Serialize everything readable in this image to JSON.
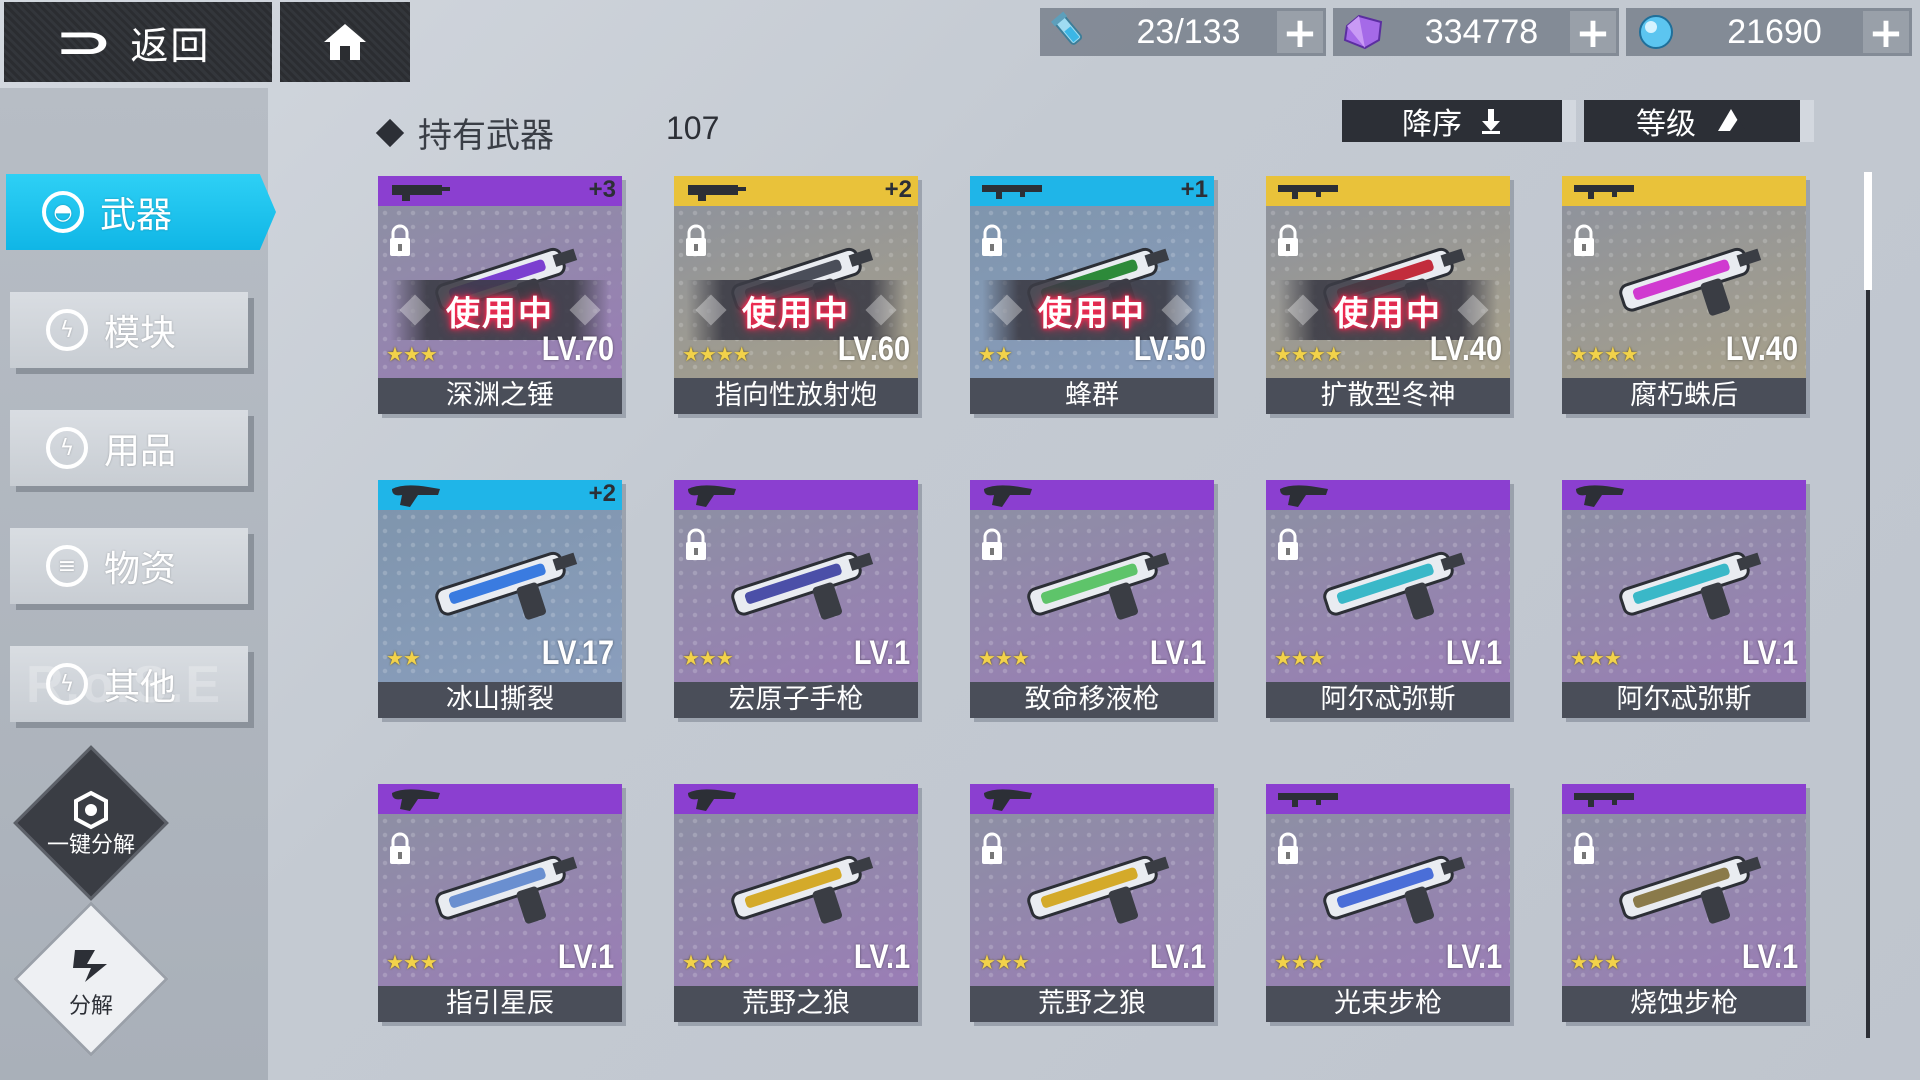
{
  "header": {
    "back_label": "返回",
    "resources": [
      {
        "icon": "stamina-vial-icon",
        "value": "23/133"
      },
      {
        "icon": "purple-crystal-icon",
        "value": "334778"
      },
      {
        "icon": "blue-orb-icon",
        "value": "21690"
      }
    ]
  },
  "sidebar": {
    "items": [
      {
        "label": "武器",
        "active": true
      },
      {
        "label": "模块",
        "active": false
      },
      {
        "label": "用品",
        "active": false
      },
      {
        "label": "物资",
        "active": false
      },
      {
        "label": "其他",
        "active": false
      }
    ],
    "watermark": "R.o.S.E",
    "bulk_dismantle": "一键分解",
    "dismantle": "分解"
  },
  "list": {
    "title": "持有武器",
    "count": "107",
    "sort_order": "降序",
    "sort_key": "等级"
  },
  "colors": {
    "accent": "#13b9e9",
    "bar_purple": "#8b3fd0",
    "bar_gold": "#e9c23a",
    "bar_blue": "#1fb5e8",
    "in_use_glow": "#ff2d55"
  },
  "weapons": [
    {
      "name": "深渊之锤",
      "level": "LV.70",
      "stars": 3,
      "plus": "+3",
      "rarity": "purple",
      "in_use": true,
      "in_use_label": "使用中",
      "locked": true,
      "icon": "heavy-gun-icon"
    },
    {
      "name": "指向性放射炮",
      "level": "LV.60",
      "stars": 4,
      "plus": "+2",
      "rarity": "gold",
      "in_use": true,
      "in_use_label": "使用中",
      "locked": true,
      "icon": "heavy-gun-icon"
    },
    {
      "name": "蜂群",
      "level": "LV.50",
      "stars": 2,
      "plus": "+1",
      "rarity": "blue",
      "in_use": true,
      "in_use_label": "使用中",
      "locked": true,
      "icon": "rifle-icon"
    },
    {
      "name": "扩散型冬神",
      "level": "LV.40",
      "stars": 4,
      "plus": "",
      "rarity": "gold",
      "in_use": true,
      "in_use_label": "使用中",
      "locked": true,
      "icon": "rifle-icon"
    },
    {
      "name": "腐朽蛛后",
      "level": "LV.40",
      "stars": 4,
      "plus": "",
      "rarity": "gold",
      "in_use": false,
      "locked": true,
      "icon": "rifle-icon"
    },
    {
      "name": "冰山撕裂",
      "level": "LV.17",
      "stars": 2,
      "plus": "+2",
      "rarity": "blue",
      "in_use": false,
      "locked": false,
      "icon": "pistol-icon"
    },
    {
      "name": "宏原子手枪",
      "level": "LV.1",
      "stars": 3,
      "plus": "",
      "rarity": "purple",
      "in_use": false,
      "locked": true,
      "icon": "pistol-icon"
    },
    {
      "name": "致命移液枪",
      "level": "LV.1",
      "stars": 3,
      "plus": "",
      "rarity": "purple",
      "in_use": false,
      "locked": true,
      "icon": "pistol-icon"
    },
    {
      "name": "阿尔忒弥斯",
      "level": "LV.1",
      "stars": 3,
      "plus": "",
      "rarity": "purple",
      "in_use": false,
      "locked": true,
      "icon": "pistol-icon"
    },
    {
      "name": "阿尔忒弥斯",
      "level": "LV.1",
      "stars": 3,
      "plus": "",
      "rarity": "purple",
      "in_use": false,
      "locked": false,
      "icon": "pistol-icon"
    },
    {
      "name": "指引星辰",
      "level": "LV.1",
      "stars": 3,
      "plus": "",
      "rarity": "purple",
      "in_use": false,
      "locked": true,
      "icon": "pistol-icon"
    },
    {
      "name": "荒野之狼",
      "level": "LV.1",
      "stars": 3,
      "plus": "",
      "rarity": "purple",
      "in_use": false,
      "locked": false,
      "icon": "pistol-icon"
    },
    {
      "name": "荒野之狼",
      "level": "LV.1",
      "stars": 3,
      "plus": "",
      "rarity": "purple",
      "in_use": false,
      "locked": true,
      "icon": "pistol-icon"
    },
    {
      "name": "光束步枪",
      "level": "LV.1",
      "stars": 3,
      "plus": "",
      "rarity": "purple",
      "in_use": false,
      "locked": true,
      "icon": "rifle-icon"
    },
    {
      "name": "烧蚀步枪",
      "level": "LV.1",
      "stars": 3,
      "plus": "",
      "rarity": "purple",
      "in_use": false,
      "locked": true,
      "icon": "rifle-icon"
    }
  ]
}
